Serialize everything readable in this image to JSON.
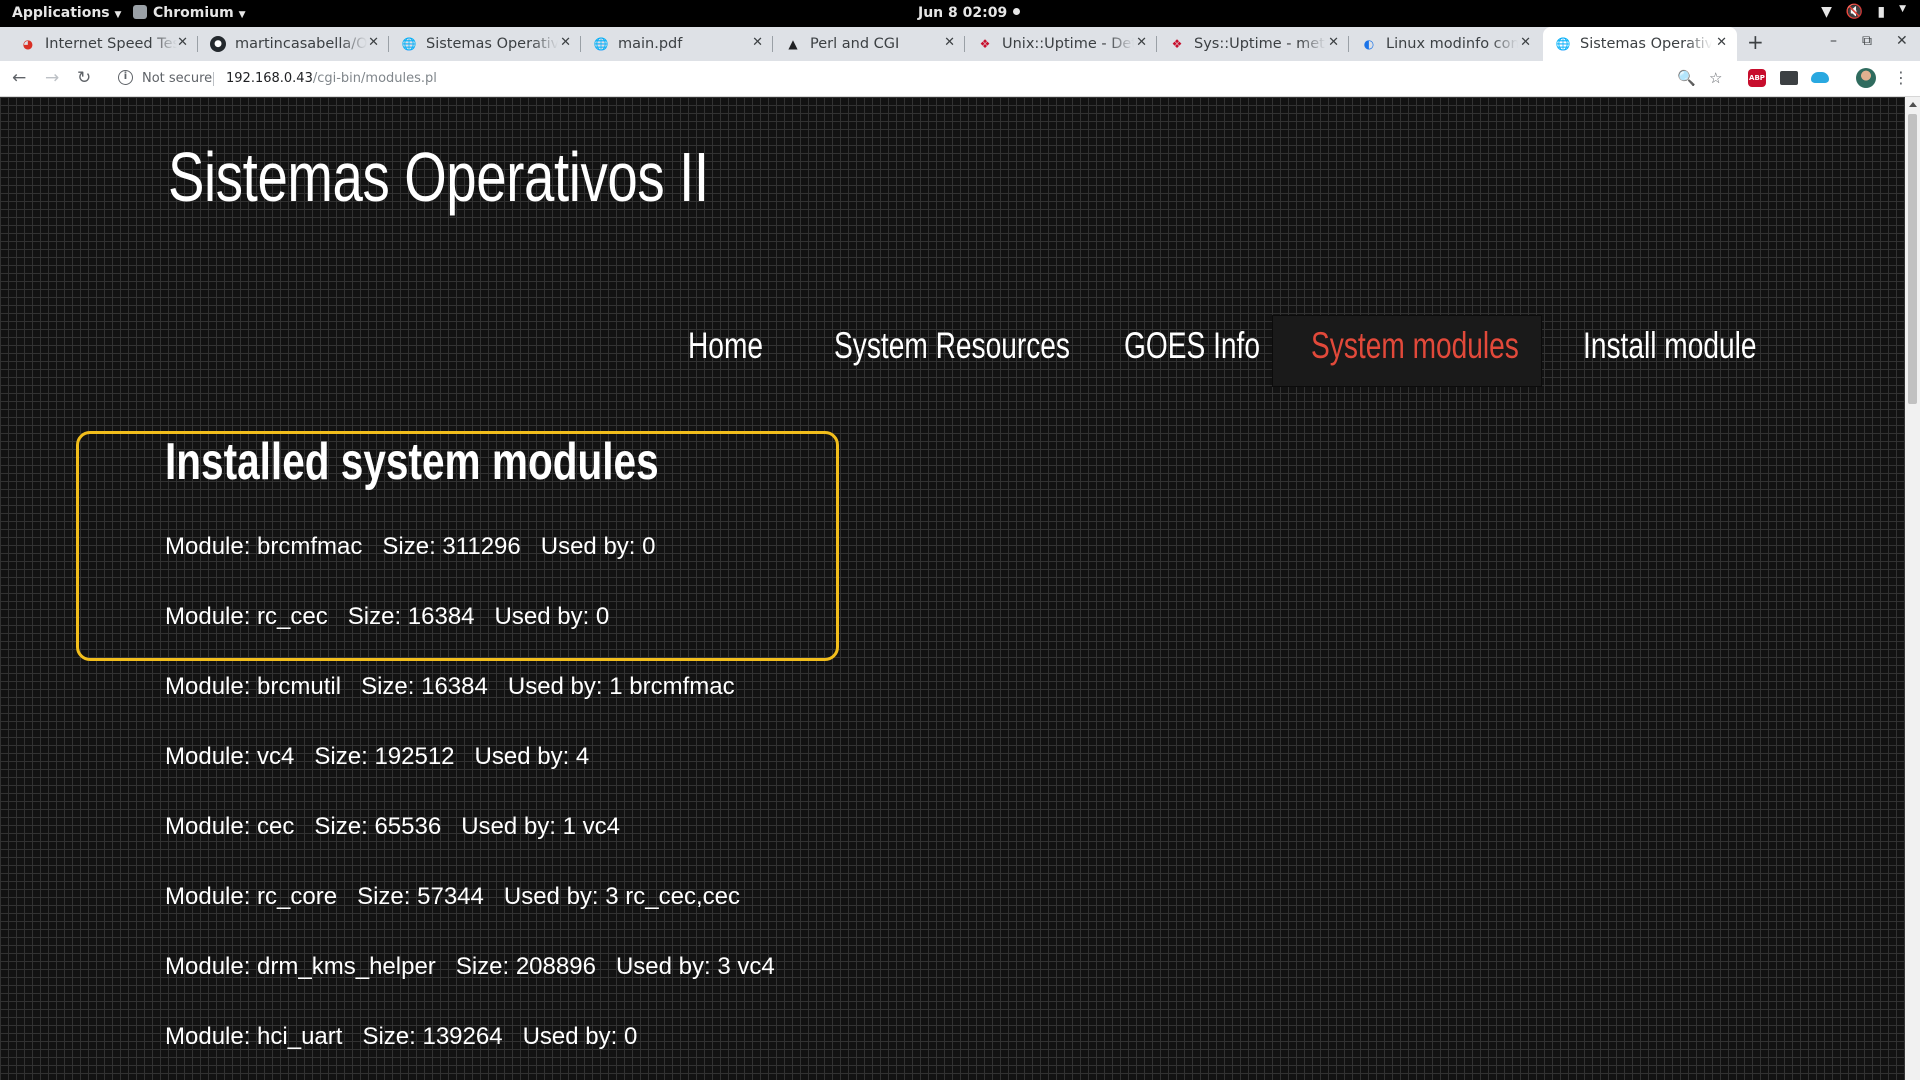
{
  "system_bar": {
    "applications_label": "Applications",
    "app_label": "Chromium",
    "clock": "Jun 8  02:09"
  },
  "tabs": [
    {
      "title": "Internet Speed Tes",
      "icon": "speedometer-icon"
    },
    {
      "title": "martincasabella/O",
      "icon": "github-icon"
    },
    {
      "title": "Sistemas Operativ",
      "icon": "globe-icon"
    },
    {
      "title": "main.pdf",
      "icon": "globe-icon"
    },
    {
      "title": "Perl and CGI",
      "icon": "camel-icon"
    },
    {
      "title": "Unix::Uptime - Det",
      "icon": "metacpan-icon"
    },
    {
      "title": "Sys::Uptime - meta",
      "icon": "metacpan-icon"
    },
    {
      "title": "Linux modinfo com",
      "icon": "blue-circle-icon"
    },
    {
      "title": "Sistemas Operativ",
      "icon": "globe-icon",
      "active": true
    }
  ],
  "address_bar": {
    "security_label": "Not secure",
    "host": "192.168.0.43",
    "path": "/cgi-bin/modules.pl"
  },
  "site": {
    "title": "Sistemas Operativos II",
    "nav": [
      {
        "label": "Home"
      },
      {
        "label": "System Resources"
      },
      {
        "label": "GOES Info"
      },
      {
        "label": "System modules",
        "active": true
      },
      {
        "label": "Install module"
      }
    ],
    "heading": "Installed system modules",
    "modules": [
      {
        "name": "Module: brcmfmac",
        "size": "Size: 311296",
        "used": "Used by: 0"
      },
      {
        "name": "Module: rc_cec",
        "size": "Size: 16384",
        "used": "Used by: 0"
      },
      {
        "name": "Module: brcmutil",
        "size": "Size: 16384",
        "used": "Used by: 1 brcmfmac"
      },
      {
        "name": "Module: vc4",
        "size": "Size: 192512",
        "used": "Used by: 4"
      },
      {
        "name": "Module: cec",
        "size": "Size: 65536",
        "used": "Used by: 1 vc4"
      },
      {
        "name": "Module: rc_core",
        "size": "Size: 57344",
        "used": "Used by: 3 rc_cec,cec"
      },
      {
        "name": "Module: drm_kms_helper",
        "size": "Size: 208896",
        "used": "Used by: 3 vc4"
      },
      {
        "name": "Module: hci_uart",
        "size": "Size: 139264",
        "used": "Used by: 0"
      }
    ]
  },
  "colors": {
    "nav_active": "#e2493a",
    "highlight_box": "#f2be1c"
  }
}
